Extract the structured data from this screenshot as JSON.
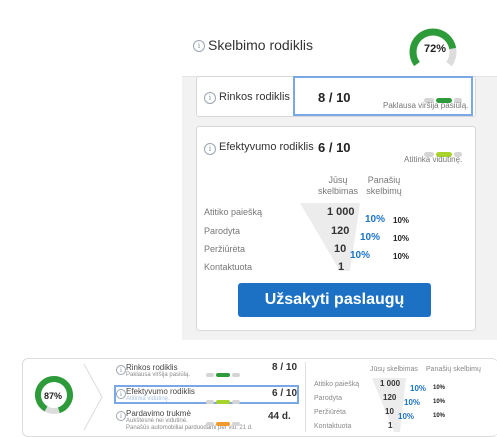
{
  "top": {
    "title": "Skelbimo rodiklis",
    "gauge_percent": "72%",
    "gauge_value": 0.72,
    "market": {
      "label": "Rinkos rodiklis",
      "score": "8 / 10",
      "note": "Paklausa viršija pasiūlą."
    },
    "efficiency": {
      "label": "Efektyvumo rodiklis",
      "score": "6 / 10",
      "note": "Atitinka vidutinę.",
      "col_yours": [
        "Jūsų",
        "skelbimas"
      ],
      "col_similar": [
        "Panašių",
        "skelbimų"
      ],
      "rows": [
        {
          "label": "Atitiko paiešką",
          "value": "1 000",
          "yours": "",
          "similar": ""
        },
        {
          "label": "Parodyta",
          "value": "120",
          "yours": "10%",
          "similar": "10%"
        },
        {
          "label": "Peržiūrėta",
          "value": "10",
          "yours": "10%",
          "similar": "10%"
        },
        {
          "label": "Kontaktuota",
          "value": "1",
          "yours": "10%",
          "similar": "10%"
        }
      ]
    },
    "order_button": "Užsakyti paslaugų"
  },
  "bottom": {
    "gauge_percent": "87%",
    "gauge_value": 0.87,
    "market": {
      "label": "Rinkos rodiklis",
      "score": "8 / 10",
      "note": "Paklausa viršija pasiūlą."
    },
    "efficiency": {
      "label": "Efektyvumo rodiklis",
      "score": "6 / 10",
      "note": "Atitinka vidutinę."
    },
    "sale": {
      "label": "Pardavimo trukmė",
      "value": "44 d.",
      "note1": "Aukštesnė nei vidutinė.",
      "note2": "Panašūs automobiliai parduodami per vid. 21 d."
    },
    "col_yours": "Jūsų skelbimas",
    "col_similar": "Panašių skelbimų",
    "rows": [
      {
        "label": "Atitiko paiešką",
        "value": "1 000",
        "yours": "10%",
        "similar": "10%"
      },
      {
        "label": "Parodyta",
        "value": "120",
        "yours": "10%",
        "similar": "10%"
      },
      {
        "label": "Peržiūrėta",
        "value": "10",
        "yours": "10%",
        "similar": "10%"
      },
      {
        "label": "Kontaktuota",
        "value": "1",
        "yours": "",
        "similar": ""
      }
    ]
  },
  "colors": {
    "accent_blue": "#1d71c5",
    "green": "#2e9b3b",
    "lime": "#a7d32a",
    "orange": "#f29a2e"
  }
}
